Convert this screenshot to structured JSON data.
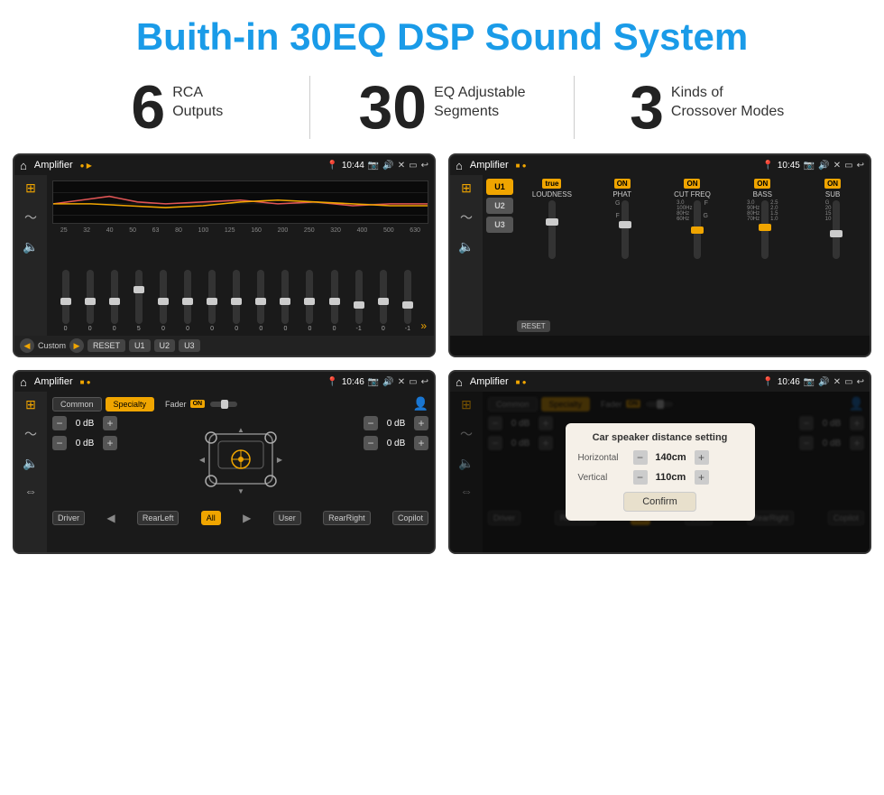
{
  "page": {
    "title": "Buith-in 30EQ DSP Sound System",
    "stats": [
      {
        "number": "6",
        "label": "RCA\nOutputs"
      },
      {
        "number": "30",
        "label": "EQ Adjustable\nSegments"
      },
      {
        "number": "3",
        "label": "Kinds of\nCrossover Modes"
      }
    ]
  },
  "screens": {
    "screen1": {
      "topbar": {
        "title": "Amplifier",
        "time": "10:44"
      },
      "eq_freqs": [
        "25",
        "32",
        "40",
        "50",
        "63",
        "80",
        "100",
        "125",
        "160",
        "200",
        "250",
        "320",
        "400",
        "500",
        "630"
      ],
      "eq_vals": [
        "0",
        "0",
        "0",
        "5",
        "0",
        "0",
        "0",
        "0",
        "0",
        "0",
        "0",
        "0",
        "-1",
        "0",
        "-1"
      ],
      "buttons": [
        "Custom",
        "RESET",
        "U1",
        "U2",
        "U3"
      ]
    },
    "screen2": {
      "topbar": {
        "title": "Amplifier",
        "time": "10:45"
      },
      "uButtons": [
        "U1",
        "U2",
        "U3"
      ],
      "modules": [
        {
          "name": "LOUDNESS",
          "on": true
        },
        {
          "name": "PHAT",
          "on": true
        },
        {
          "name": "CUT FREQ",
          "on": true
        },
        {
          "name": "BASS",
          "on": true
        },
        {
          "name": "SUB",
          "on": true
        }
      ],
      "reset": "RESET"
    },
    "screen3": {
      "topbar": {
        "title": "Amplifier",
        "time": "10:46"
      },
      "tabs": [
        "Common",
        "Specialty"
      ],
      "fader_label": "Fader",
      "on_label": "ON",
      "channels": [
        {
          "label": "",
          "db": "0 dB"
        },
        {
          "label": "",
          "db": "0 dB"
        },
        {
          "label": "",
          "db": "0 dB"
        },
        {
          "label": "",
          "db": "0 dB"
        }
      ],
      "bottom_buttons": [
        "Driver",
        "",
        "RearLeft",
        "All",
        "",
        "User",
        "RearRight",
        "Copilot"
      ]
    },
    "screen4": {
      "topbar": {
        "title": "Amplifier",
        "time": "10:46"
      },
      "tabs": [
        "Common",
        "Specialty"
      ],
      "dialog": {
        "title": "Car speaker distance setting",
        "horizontal_label": "Horizontal",
        "horizontal_val": "140cm",
        "vertical_label": "Vertical",
        "vertical_val": "110cm",
        "confirm_label": "Confirm"
      },
      "bottom_buttons": [
        "Driver",
        "RearLeft",
        "All",
        "User",
        "RearRight",
        "Copilot"
      ]
    }
  },
  "icons": {
    "home": "⌂",
    "back": "↩",
    "location": "📍",
    "sound": "🔊",
    "close": "✕",
    "window": "▭",
    "play": "▶",
    "pause": "⏸",
    "left": "◀",
    "right": "▶",
    "filter": "≡",
    "wave": "〜",
    "speaker": "🔈",
    "plus": "+",
    "minus": "−",
    "chevron_up": "▲",
    "chevron_down": "▼",
    "person": "👤"
  }
}
